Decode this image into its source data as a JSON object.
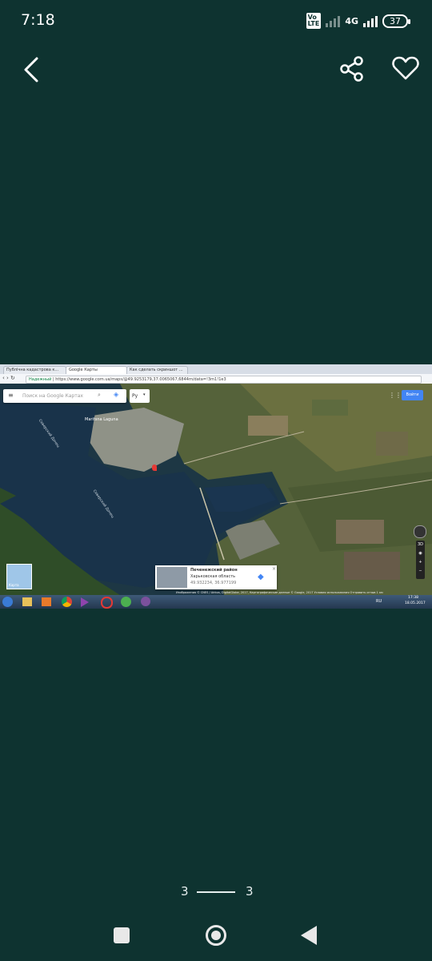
{
  "status_bar": {
    "time": "7:18",
    "volte_label": "Vo LTE",
    "network_label": "4G",
    "battery": "37"
  },
  "toolbar": {
    "back_icon": "chevron-left-icon",
    "share_icon": "share-icon",
    "favorite_icon": "heart-outline-icon"
  },
  "screenshot": {
    "browser_tabs": [
      {
        "label": "Публічна кадастрова к..."
      },
      {
        "label": "Google Карты"
      },
      {
        "label": "Как сделать скриншот ..."
      }
    ],
    "url_security": "Надежный",
    "url": "https://www.google.com.ua/maps/@49.9253179,37.0065067,6844m/data=!3m1!1e3",
    "map_search_placeholder": "Поиск на Google Картах",
    "language_button": "Ру",
    "sign_in_button": "Войти",
    "place_label": "Maritsna Laguna",
    "river_label_1": "Северский Донец",
    "river_label_2": "Северский Донец",
    "layer_toggle_label": "Карта",
    "info_card": {
      "title": "Печенежский район",
      "subtitle": "Харьковская область",
      "coords": "49.932234, 36.977199"
    },
    "attribution": "Изображения © CNES / Airbus, DigitalGlobe, 2017, Картографические данные © Google, 2017   Условия использования   Отправить отзыв   1 км",
    "taskbar_time": "17:38",
    "taskbar_date": "18.05.2017",
    "taskbar_lang": "RU"
  },
  "pager": {
    "current": "3",
    "total": "3"
  },
  "nav": {
    "recents_icon": "square-icon",
    "home_icon": "circle-icon",
    "back_icon": "triangle-back-icon"
  }
}
